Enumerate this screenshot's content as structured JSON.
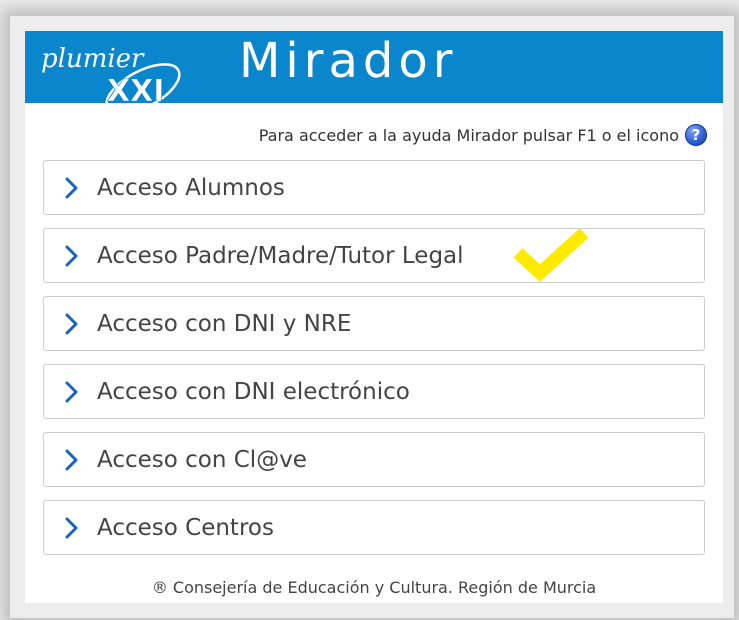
{
  "header": {
    "logo_text": "plumier XXI",
    "title": "Mirador",
    "background_color": "#0a86cc"
  },
  "help": {
    "text": "Para acceder a la ayuda Mirador pulsar F1 o el icono",
    "icon": "help-icon",
    "icon_glyph": "?"
  },
  "menu": {
    "items": [
      {
        "label": "Acceso Alumnos",
        "icon": "chevron-right-icon"
      },
      {
        "label": "Acceso Padre/Madre/Tutor Legal",
        "icon": "chevron-right-icon",
        "marked": true
      },
      {
        "label": "Acceso con DNI y NRE",
        "icon": "chevron-right-icon"
      },
      {
        "label": "Acceso con DNI electrónico",
        "icon": "chevron-right-icon"
      },
      {
        "label": "Acceso con Cl@ve",
        "icon": "chevron-right-icon"
      },
      {
        "label": "Acceso Centros",
        "icon": "chevron-right-icon"
      }
    ],
    "chevron_color": "#1565c0",
    "checkmark_color": "#ffea00"
  },
  "footer": {
    "text": "® Consejería de Educación y Cultura. Región de Murcia"
  }
}
